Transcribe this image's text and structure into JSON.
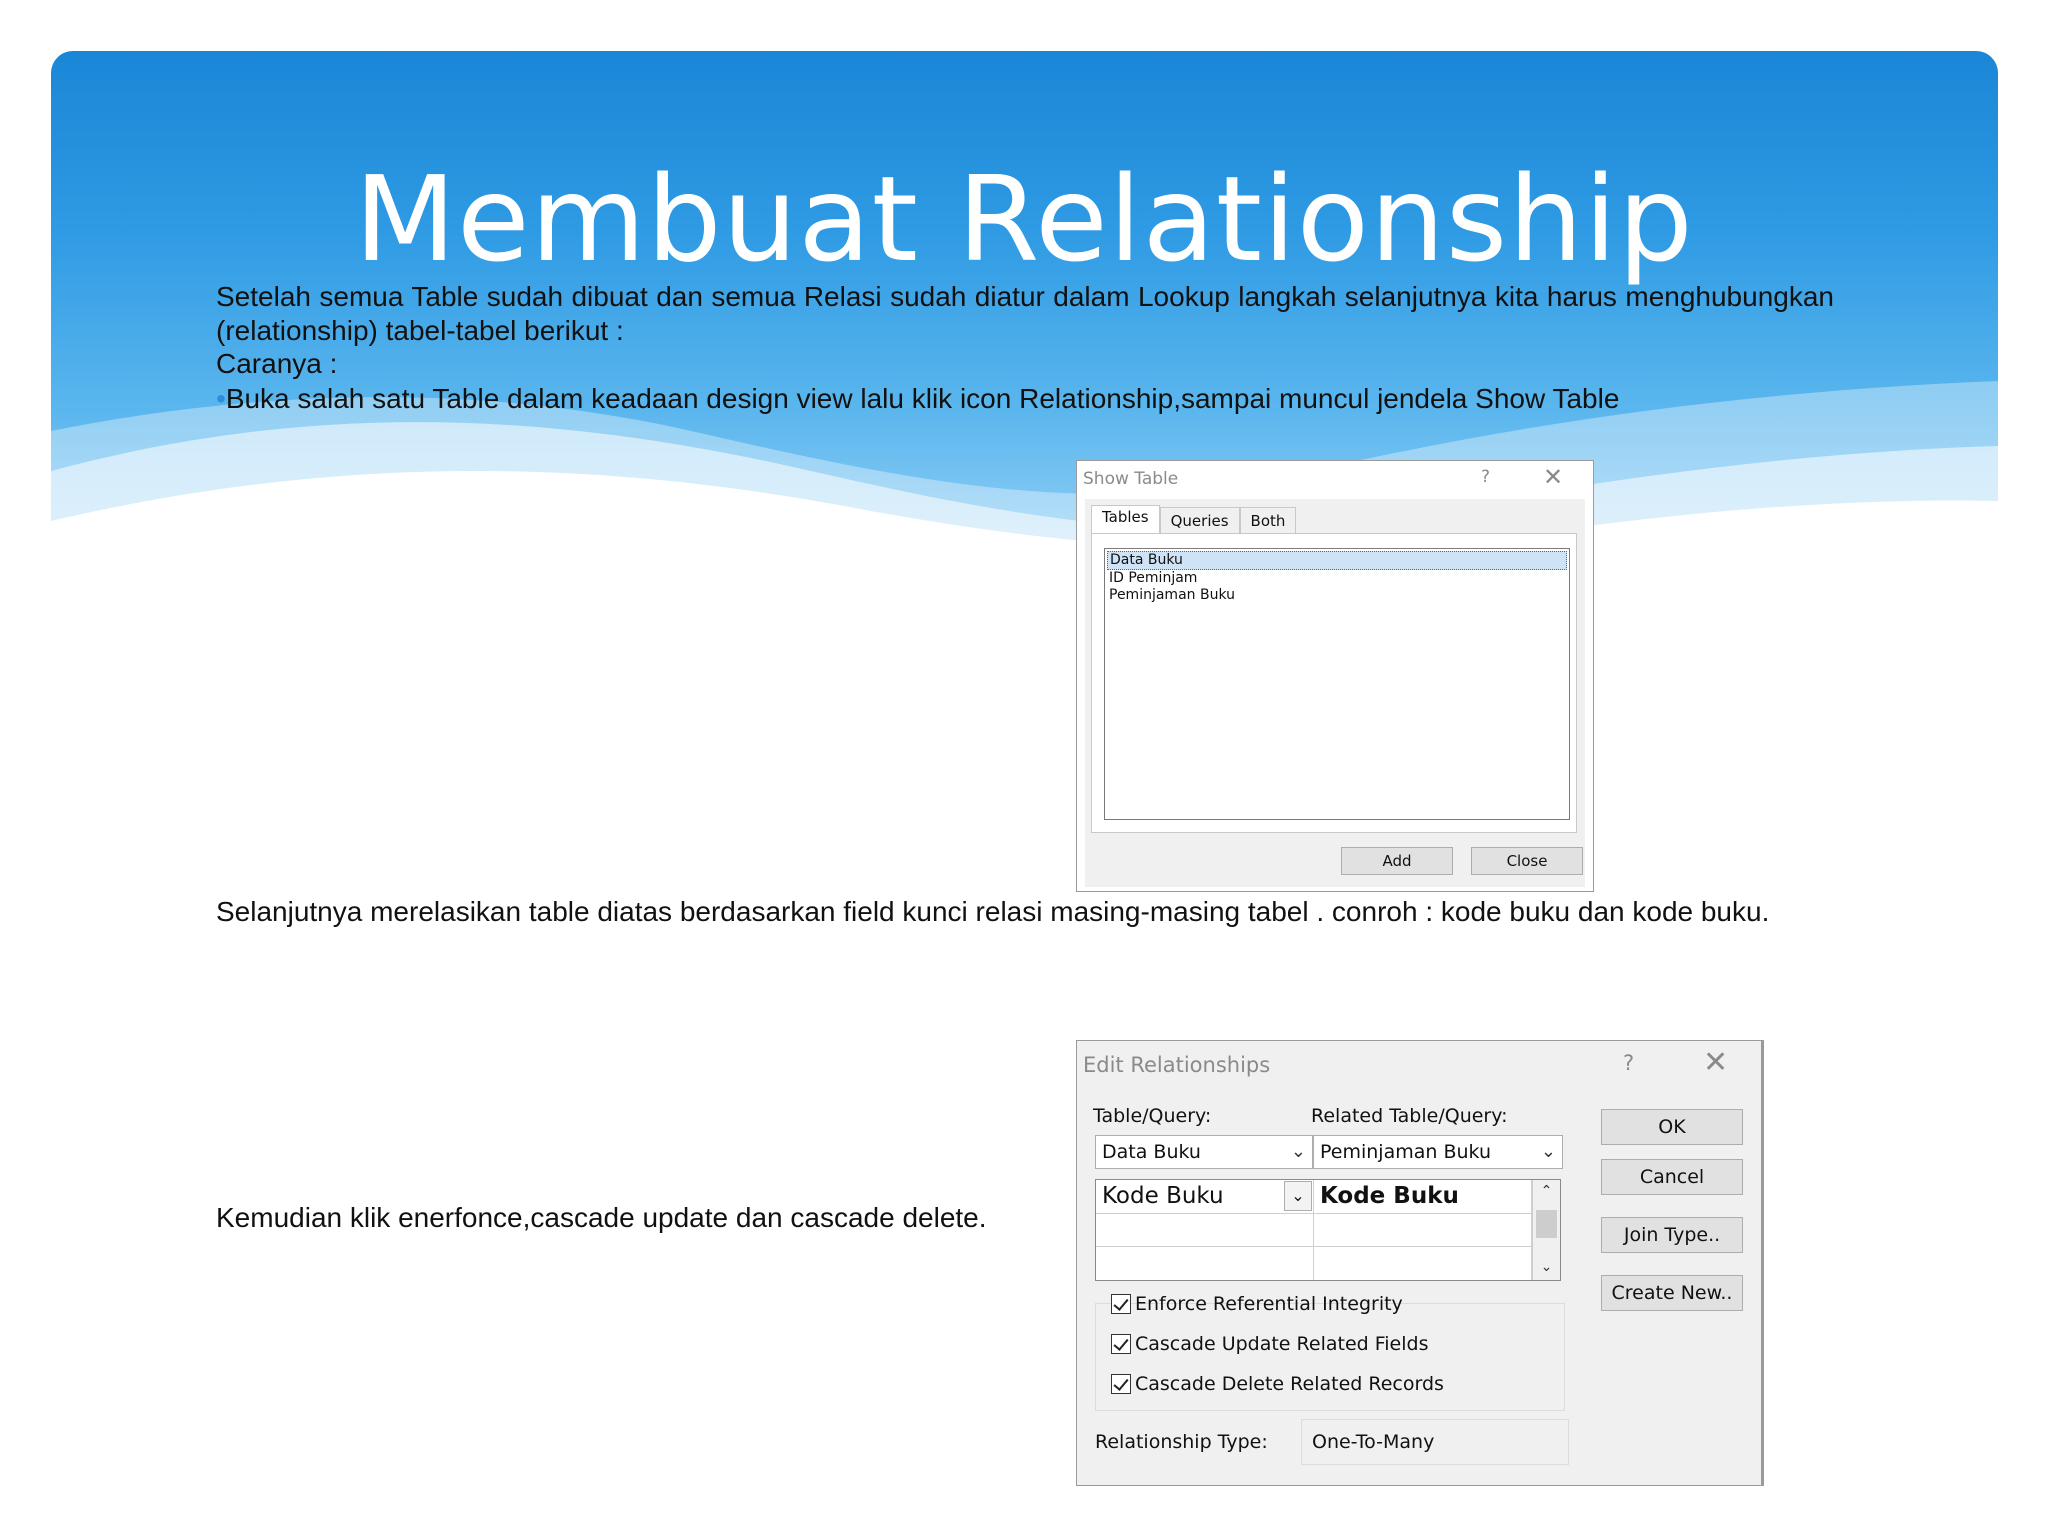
{
  "slide": {
    "title": "Membuat Relationship",
    "paragraph1": "Setelah semua Table sudah dibuat dan semua Relasi sudah diatur dalam Lookup langkah selanjutnya kita harus menghubungkan (relationship) tabel-tabel berikut :",
    "caranya": "Caranya :",
    "bullet_symbol": "•",
    "bullet1": "Buka salah satu Table dalam keadaan design view lalu klik icon Relationship,sampai muncul jendela Show Table",
    "paragraph2": "Selanjutnya merelasikan table diatas berdasarkan field kunci relasi masing-masing tabel . conroh : kode buku dan kode buku.",
    "paragraph3": "Kemudian klik enerfonce,cascade update dan cascade delete."
  },
  "show_table": {
    "title": "Show Table",
    "help": "?",
    "close_glyph": "✕",
    "tabs": [
      "Tables",
      "Queries",
      "Both"
    ],
    "items": [
      "Data Buku",
      "ID Peminjam",
      "Peminjaman Buku"
    ],
    "add_label": "Add",
    "close_label": "Close"
  },
  "edit_relationships": {
    "title": "Edit Relationships",
    "help": "?",
    "close_glyph": "✕",
    "table_query_label": "Table/Query:",
    "related_label": "Related Table/Query:",
    "table_value": "Data Buku",
    "related_value": "Peminjaman Buku",
    "field_left": "Kode Buku",
    "field_right": "Kode Buku",
    "enforce_label": "Enforce Referential Integrity",
    "cascade_update_label": "Cascade Update Related Fields",
    "cascade_delete_label": "Cascade Delete Related Records",
    "relationship_type_label": "Relationship Type:",
    "relationship_type_value": "One-To-Many",
    "ok_label": "OK",
    "cancel_label": "Cancel",
    "join_type_label": "Join Type..",
    "create_new_label": "Create New.."
  },
  "colors": {
    "title_band": "#2f9be4",
    "bullet": "#2d8fd8"
  }
}
